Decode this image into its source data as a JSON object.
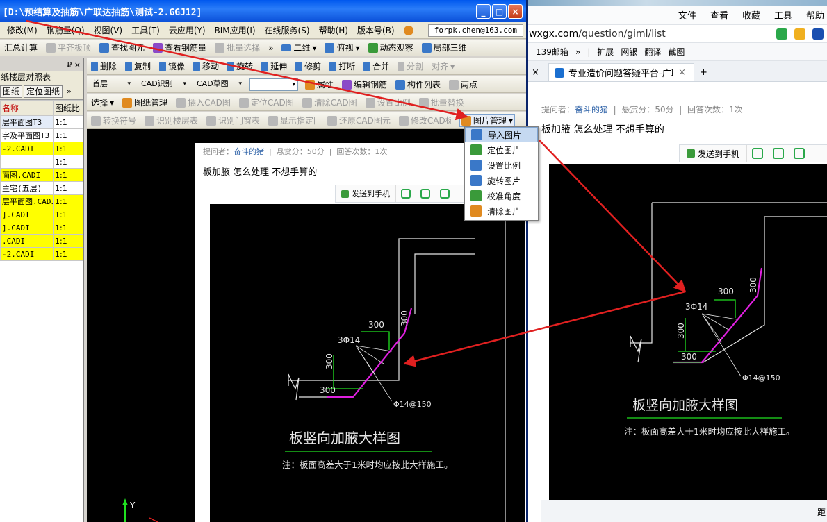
{
  "browser": {
    "menu": [
      "文件",
      "查看",
      "收藏",
      "工具",
      "帮助"
    ],
    "address_domain": "wxgx.com",
    "address_path": "/question/giml/list",
    "favorites": [
      "139邮箱",
      "»",
      "扩展",
      "网银",
      "翻译",
      "截图"
    ],
    "tab_title": "专业造价问题答疑平台-广联达",
    "tab_close": "×",
    "tab_new": "+",
    "meta_asker_label": "提问者：",
    "meta_asker": "奋斗的猪",
    "meta_reward": "悬赏分：50分",
    "meta_answers": "回答次数：1次",
    "question": "板加腋 怎么处理 不想手算的",
    "send_to_phone": "发送到手机",
    "bottom_text": "距"
  },
  "app": {
    "title": "[D:\\预结算及抽筋\\广联达抽筋\\测试-2.GGJ12]",
    "window_buttons": [
      "_",
      "□",
      "×"
    ],
    "menu": [
      "修改(M)",
      "钢筋量(Q)",
      "视图(V)",
      "工具(T)",
      "云应用(Y)",
      "BIM应用(I)",
      "在线服务(S)",
      "帮助(H)",
      "版本号(B)"
    ],
    "account": "forpk.chen@163.com",
    "toolbar1": [
      "汇总计算",
      "平齐板顶",
      "查找图元",
      "查看钢筋量",
      "批量选择"
    ],
    "view_2d": "二维",
    "view_top": "俯视",
    "toolbar1_right": [
      "动态观察",
      "局部三维"
    ],
    "toolbar2": [
      "删除",
      "复制",
      "镜像",
      "移动",
      "旋转",
      "延伸",
      "修剪",
      "打断",
      "合并",
      "分割",
      "对齐"
    ],
    "toolbar3_dd": [
      "首层",
      "CAD识别",
      "CAD草图",
      ""
    ],
    "toolbar3": [
      "属性",
      "编辑钢筋",
      "构件列表",
      "两点"
    ],
    "toolbar4": [
      "选择",
      "图纸管理",
      "插入CAD图",
      "定位CAD图",
      "清除CAD图",
      "设置比例",
      "批量替换"
    ],
    "toolbar5": [
      "转换符号",
      "识别楼层表",
      "识别门窗表",
      "显示指定图层",
      "还原CAD图元",
      "修改CAD标注",
      "图片管理"
    ],
    "left_panel": {
      "pin": "₽ ×",
      "tab": "纸楼层对照表",
      "buttons": [
        "图纸",
        "定位图纸"
      ],
      "headers": [
        "名称",
        "图纸比"
      ],
      "rows": [
        {
          "name": "层平面图T3",
          "ratio": "1:1",
          "hl": "sel"
        },
        {
          "name": "字及平面图T3",
          "ratio": "1:1",
          "hl": ""
        },
        {
          "name": "-2.CADI",
          "ratio": "1:1",
          "hl": "y"
        },
        {
          "name": "",
          "ratio": "1:1",
          "hl": ""
        },
        {
          "name": "面图.CADI",
          "ratio": "1:1",
          "hl": "y"
        },
        {
          "name": "主宅(五层)",
          "ratio": "1:1",
          "hl": ""
        },
        {
          "name": "层平面图.CADI",
          "ratio": "1:1",
          "hl": "y"
        },
        {
          "name": "].CADI",
          "ratio": "1:1",
          "hl": "y"
        },
        {
          "name": "].CADI",
          "ratio": "1:1",
          "hl": "y"
        },
        {
          "name": ".CADI",
          "ratio": "1:1",
          "hl": "y"
        },
        {
          "name": "-2.CADI",
          "ratio": "1:1",
          "hl": "y"
        }
      ]
    },
    "picture_menu": [
      "导入图片",
      "定位图片",
      "设置比例",
      "旋转图片",
      "校准角度",
      "清除图片"
    ],
    "axis_y": "Y"
  },
  "drawing": {
    "dim_300_a": "300",
    "dim_300_b": "300",
    "dim_300_c": "300",
    "dim_300_d": "300",
    "rebar_label": "3Φ14",
    "stirrup_label": "Φ14@150",
    "title": "板竖向加腋大样图",
    "note": "注：板面高差大于1米时均应按此大样施工。"
  },
  "colors": {
    "titlebar": "#0a4fd8",
    "highlight_row": "#ffff00",
    "arrow": "#e02020",
    "rebar": "#e020e0",
    "dim": "#20e020"
  }
}
